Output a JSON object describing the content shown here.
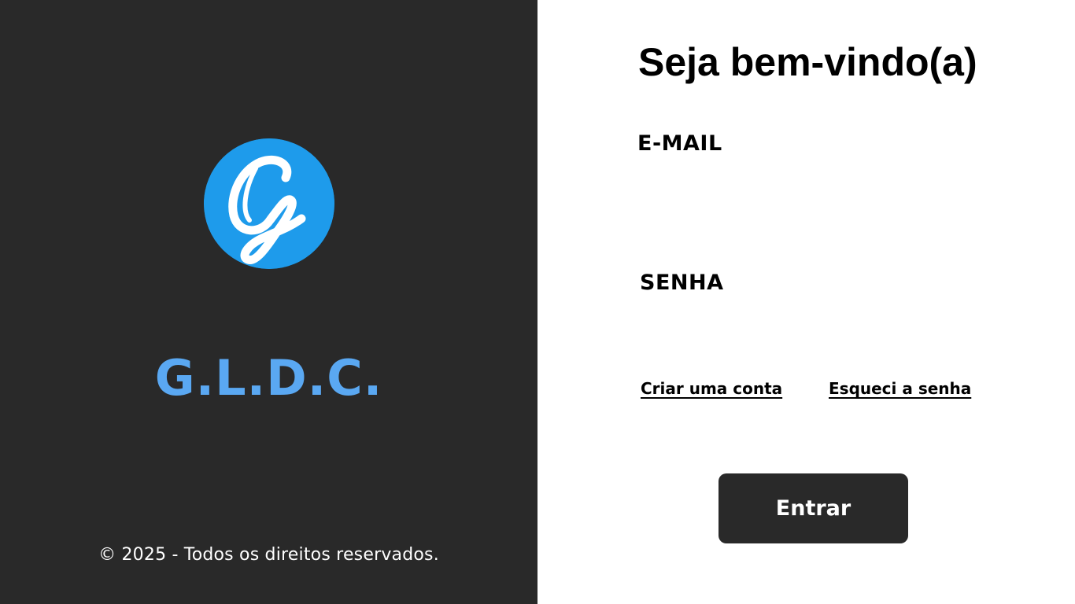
{
  "brand": {
    "logo_icon": "script-g-logo-icon",
    "logo_letter": "G",
    "logo_color": "#1e9beb",
    "name": "G.L.D.C.",
    "name_color": "#5aa8f2",
    "panel_color": "#292929"
  },
  "footer": {
    "copyright": "© 2025 - Todos os direitos reservados."
  },
  "login": {
    "title": "Seja bem-vindo(a)",
    "email_label": "E-MAIL",
    "email_value": "",
    "email_placeholder": "",
    "password_label": "SENHA",
    "password_value": "",
    "password_placeholder": "",
    "create_account_link": "Criar uma conta",
    "forgot_password_link": "Esqueci a senha",
    "submit_label": "Entrar"
  }
}
